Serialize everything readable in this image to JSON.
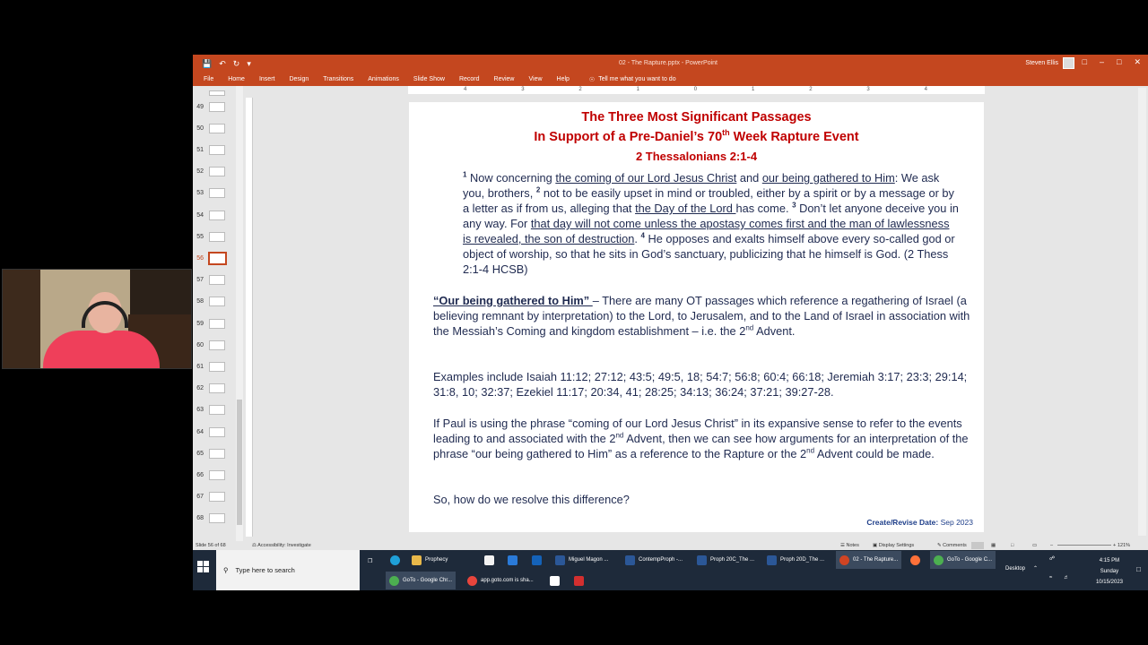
{
  "window": {
    "title": "02 - The Rapture.pptx - PowerPoint",
    "user": "Steven Ellis",
    "menu_tabs": [
      "File",
      "Home",
      "Insert",
      "Design",
      "Transitions",
      "Animations",
      "Slide Show",
      "Record",
      "Review",
      "View",
      "Help"
    ],
    "tell_me": "Tell me what you want to do"
  },
  "ruler": {
    "h_ticks": [
      "4",
      "3",
      "2",
      "1",
      "0",
      "1",
      "2",
      "3",
      "4"
    ]
  },
  "thumbnails": {
    "items": [
      {
        "num": "49"
      },
      {
        "num": "50"
      },
      {
        "num": "51"
      },
      {
        "num": "52"
      },
      {
        "num": "53"
      },
      {
        "num": "54"
      },
      {
        "num": "55"
      },
      {
        "num": "56",
        "active": true
      },
      {
        "num": "57"
      },
      {
        "num": "58"
      },
      {
        "num": "59"
      },
      {
        "num": "60"
      },
      {
        "num": "61"
      },
      {
        "num": "62"
      },
      {
        "num": "63"
      },
      {
        "num": "64"
      },
      {
        "num": "65"
      },
      {
        "num": "66"
      },
      {
        "num": "67"
      },
      {
        "num": "68"
      }
    ]
  },
  "slide": {
    "title_line1": "The Three Most Significant Passages",
    "title_line2_a": "In Support of a Pre-Daniel’s 70",
    "title_line2_sup": "th",
    "title_line2_b": " Week Rapture Event",
    "reference": "2 Thessalonians 2:1-4",
    "passage": {
      "v1": "1",
      "t1": " Now concerning ",
      "u1": "the coming of our Lord Jesus Christ",
      "t2": " and ",
      "u2": "our being gathered to Him",
      "t3": ": We ask you, brothers, ",
      "v2": "2",
      "t4": " not to be easily upset in mind or troubled, either by a spirit or by a message or by a letter as if from us, alleging that ",
      "u3": "the Day of the Lord ",
      "t5": "has come. ",
      "v3": "3",
      "t6": " Don’t let anyone deceive you in any way. For ",
      "u4": "that day will not come unless the apostasy comes first and the man of lawlessness is revealed, the son of destruction",
      "t7": ". ",
      "v4": "4",
      "t8": " He opposes and exalts himself above every so-called god or object of worship, so that he sits in God’s sanctuary, publicizing that he himself is God. (2 Thess 2:1-4 HCSB)"
    },
    "para1": {
      "lead": "“Our being gathered to Him” ",
      "text": "– There are many OT passages which reference a regathering of Israel (a believing remnant by interpretation) to the Lord, to Jerusalem, and to the Land of Israel in association with the Messiah’s Coming and kingdom establishment – i.e. the 2",
      "sup": "nd",
      "end": " Advent."
    },
    "para2": "Examples include Isaiah 11:12; 27:12; 43:5; 49:5, 18; 54:7; 56:8; 60:4; 66:18; Jeremiah 3:17; 23:3; 29:14; 31:8, 10; 32:37; Ezekiel 11:17; 20:34, 41; 28:25; 34:13; 36:24; 37:21; 39:27-28.",
    "para3": {
      "a": "If Paul is using the phrase “coming of our Lord Jesus Christ” in its expansive sense to refer to the events leading to and associated with the 2",
      "sup1": "nd",
      "b": " Advent, then we can see how arguments for an interpretation of the phrase “our being gathered to Him” as a reference to the Rapture or the 2",
      "sup2": "nd",
      "c": " Advent could be made."
    },
    "para4": "So, how do we resolve this difference?",
    "create_label": "Create/Revise Date:",
    "create_date": "Sep 2023"
  },
  "status": {
    "slide_of": "Slide 56 of 68",
    "accessibility": "Accessibility: Investigate",
    "notes": "Notes",
    "display": "Display Settings",
    "comments": "Comments",
    "zoom": "121%"
  },
  "taskbar": {
    "search_placeholder": "Type here to search",
    "row1": [
      "Prophecy",
      "Miguel Magon ...",
      "ContempProph -...",
      "Proph 20C_The ...",
      "Proph 20D_The ...",
      "02 - The Rapture...",
      "GoTo - Google C..."
    ],
    "row2": [
      "GoTo - Google Chr...",
      "app.goto.com is sha..."
    ],
    "desktop": "Desktop",
    "time": "4:15 PM",
    "day": "Sunday",
    "date": "10/15/2023"
  },
  "colors": {
    "title_bar": "#c4471f",
    "slide_title": "#c00000",
    "body_text": "#1f2a50"
  }
}
